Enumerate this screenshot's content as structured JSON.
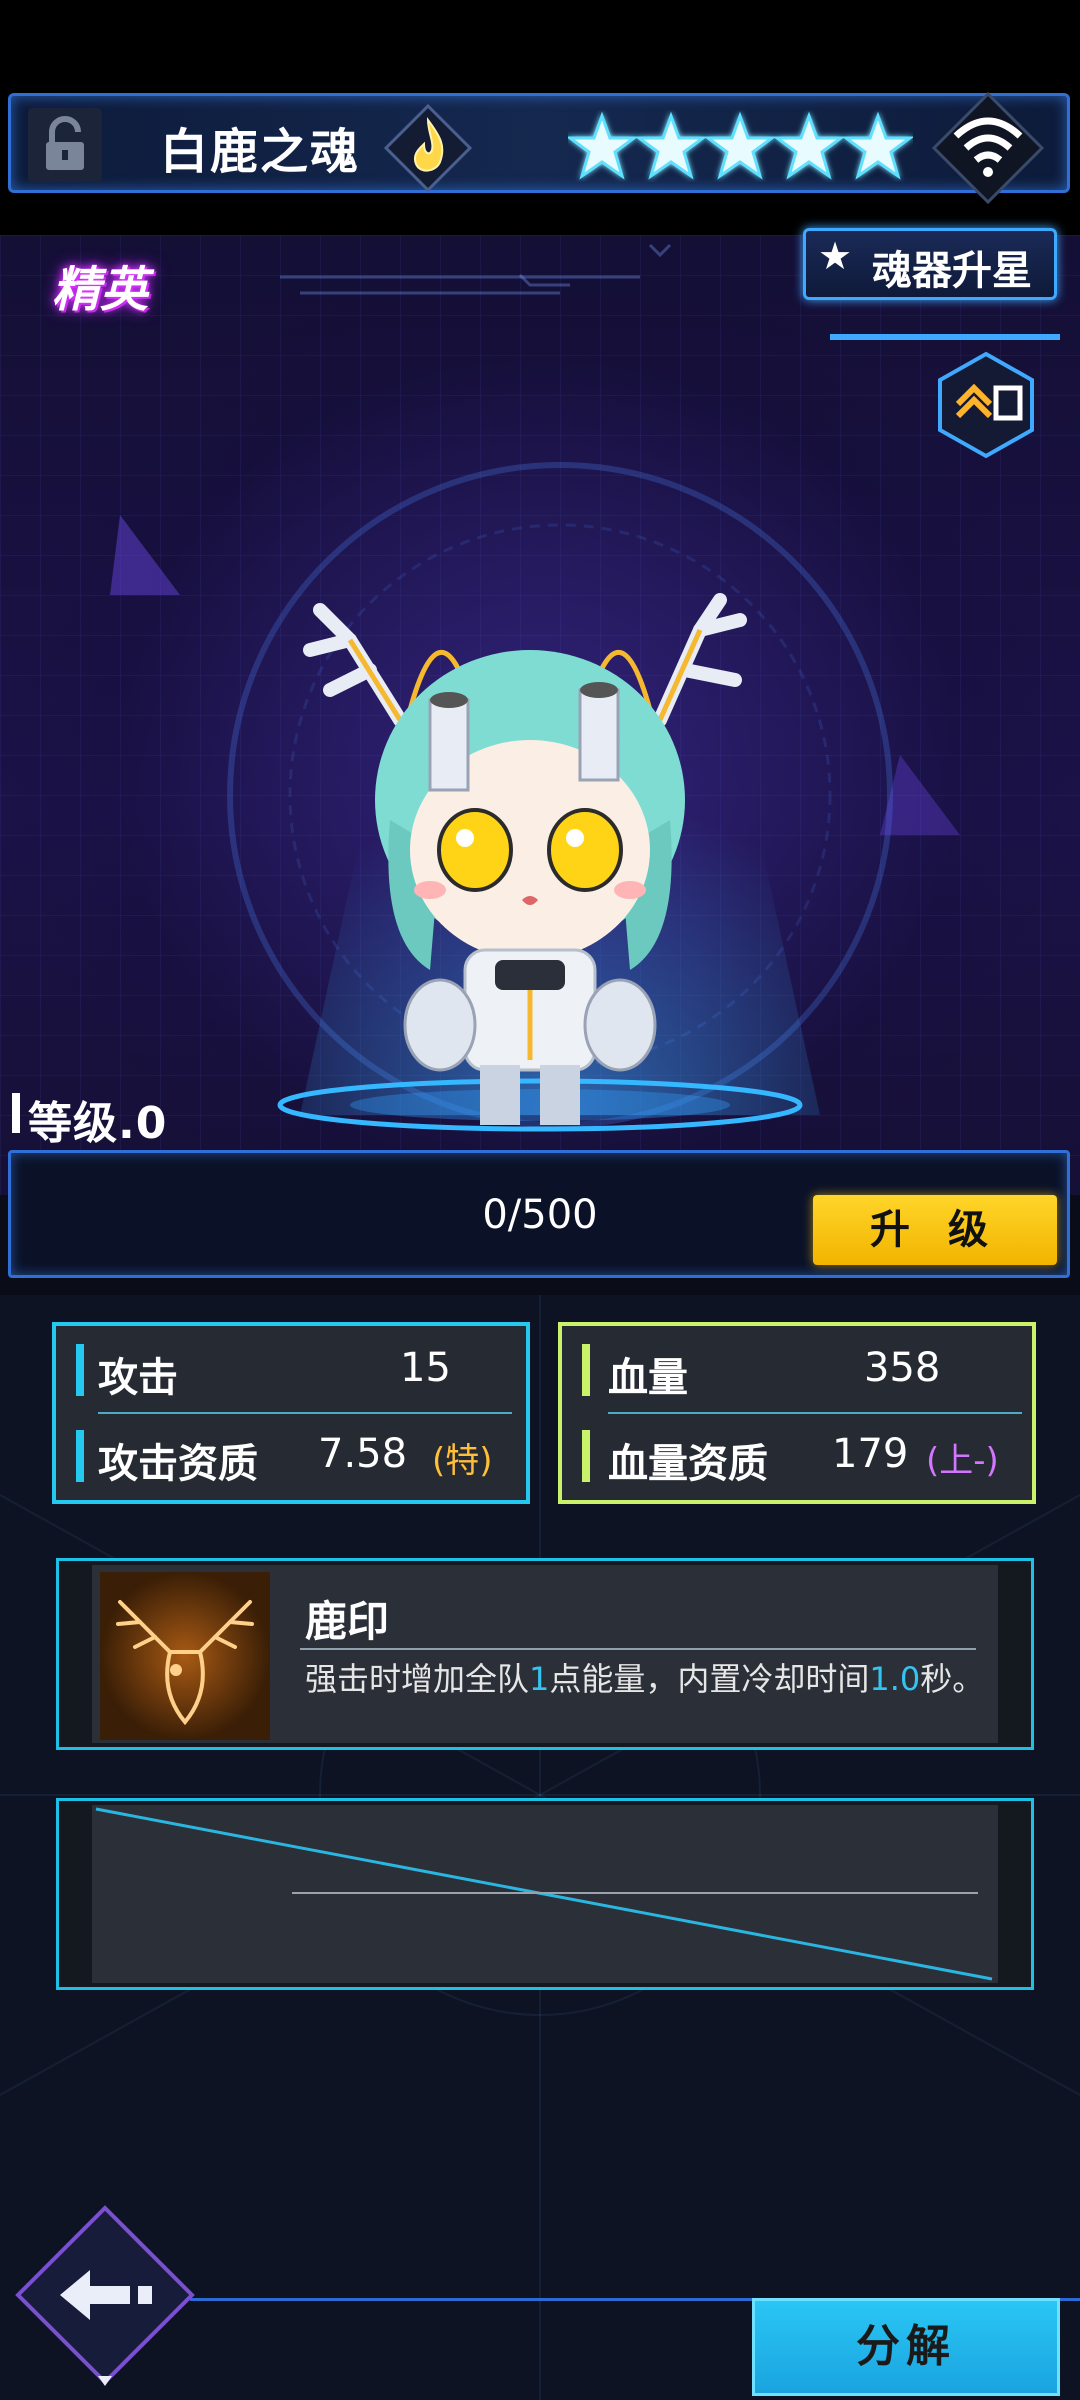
{
  "header": {
    "title": "白鹿之魂",
    "star_count": 5,
    "lock_icon": "lock-icon",
    "rarity_icon": "flame-icon",
    "signal_icon": "wifi-icon"
  },
  "stage": {
    "grade_badge": "精英",
    "star_up_button": "魂器升星",
    "expand_icon": "expand-icon"
  },
  "level": {
    "label": "等级.0",
    "xp_text": "0/500",
    "upgrade_button": "升 级"
  },
  "stats": {
    "attack_label": "攻击",
    "attack_value": "15",
    "attack_quality_label": "攻击资质",
    "attack_quality_value": "7.58",
    "attack_quality_tag": "(特)",
    "hp_label": "血量",
    "hp_value": "358",
    "hp_quality_label": "血量资质",
    "hp_quality_value": "179",
    "hp_quality_tag": "(上-)"
  },
  "skill": {
    "name": "鹿印",
    "icon": "deer-icon",
    "desc_part1": "强击时增加全队",
    "desc_hl1": "1",
    "desc_part2": "点能量，内置冷却时间",
    "desc_hl2": "1.0",
    "desc_part3": "秒。"
  },
  "footer": {
    "back_icon": "back-arrow-icon",
    "decompose_button": "分解"
  },
  "colors": {
    "cyan": "#25c8ee",
    "green": "#c9f26a",
    "gold": "#ffd52a",
    "blue_border": "#2f6fd6"
  }
}
